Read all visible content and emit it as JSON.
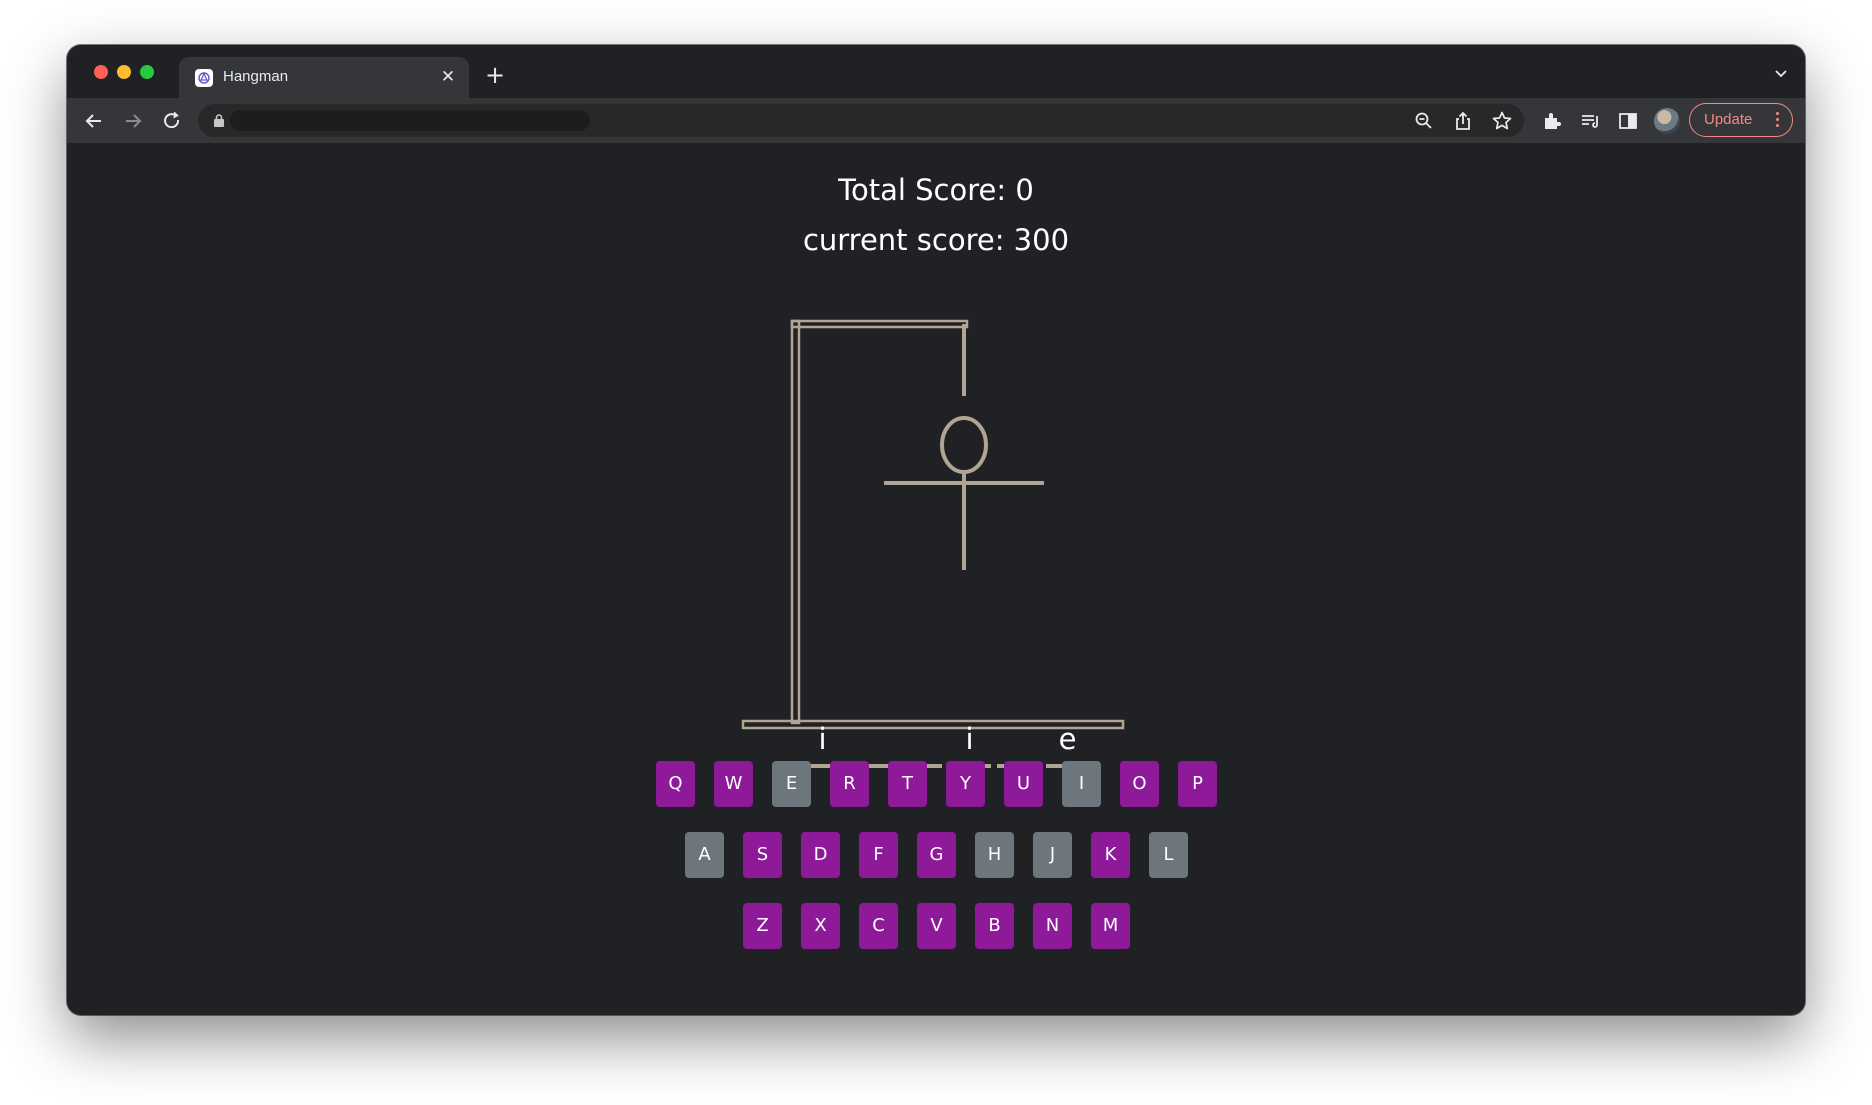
{
  "browser": {
    "tab_title": "Hangman",
    "tab_close": "✕",
    "new_tab": "+",
    "update_label": "Update",
    "accent_update": "#f28b82",
    "icons": [
      "back-icon",
      "forward-icon",
      "reload-icon",
      "lock-icon",
      "zoom-icon",
      "share-icon",
      "bookmark-star-icon",
      "extensions-icon",
      "media-icon",
      "side-panel-icon",
      "profile-avatar",
      "more-menu-icon"
    ]
  },
  "game": {
    "total_score_text": "Total Score: 0",
    "current_score_text": "current score: 300",
    "word_slots": [
      "i",
      "",
      "",
      "i",
      "",
      "e"
    ],
    "hangman_parts_drawn": [
      "head",
      "body",
      "arms"
    ],
    "colors": {
      "available_key": "#8e1a9a",
      "used_key": "#6d757d",
      "gallows": "#b0a593"
    },
    "keyboard": {
      "rows": [
        [
          {
            "letter": "Q",
            "state": "available"
          },
          {
            "letter": "W",
            "state": "available"
          },
          {
            "letter": "E",
            "state": "used"
          },
          {
            "letter": "R",
            "state": "available"
          },
          {
            "letter": "T",
            "state": "available"
          },
          {
            "letter": "Y",
            "state": "available"
          },
          {
            "letter": "U",
            "state": "available"
          },
          {
            "letter": "I",
            "state": "used"
          },
          {
            "letter": "O",
            "state": "available"
          },
          {
            "letter": "P",
            "state": "available"
          }
        ],
        [
          {
            "letter": "A",
            "state": "used"
          },
          {
            "letter": "S",
            "state": "available"
          },
          {
            "letter": "D",
            "state": "available"
          },
          {
            "letter": "F",
            "state": "available"
          },
          {
            "letter": "G",
            "state": "available"
          },
          {
            "letter": "H",
            "state": "used"
          },
          {
            "letter": "J",
            "state": "used"
          },
          {
            "letter": "K",
            "state": "available"
          },
          {
            "letter": "L",
            "state": "used"
          }
        ],
        [
          {
            "letter": "Z",
            "state": "available"
          },
          {
            "letter": "X",
            "state": "available"
          },
          {
            "letter": "C",
            "state": "available"
          },
          {
            "letter": "V",
            "state": "available"
          },
          {
            "letter": "B",
            "state": "available"
          },
          {
            "letter": "N",
            "state": "available"
          },
          {
            "letter": "M",
            "state": "available"
          }
        ]
      ]
    }
  }
}
